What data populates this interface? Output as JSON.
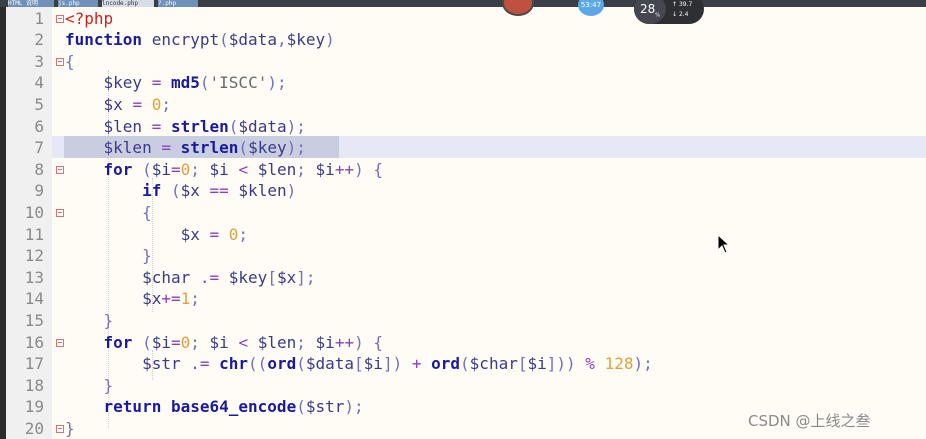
{
  "tabs": [
    "HTML 说明",
    "js.php",
    "lncode.php",
    "?.php"
  ],
  "overlay": {
    "time": "53:47",
    "net_value": "28",
    "net_unit": "%",
    "net_up": "39.7",
    "net_down": "2.4"
  },
  "watermark": "CSDN @上线之叁",
  "lines": [
    {
      "n": "1",
      "fold": true,
      "html": "<span class=\"tag\">&lt;?php</span>"
    },
    {
      "n": "2",
      "fold": false,
      "html": "<span class=\"kw\">function</span> <span class=\"var\">encrypt</span><span class=\"punc\">(</span><span class=\"var\">$data</span><span class=\"punc\">,</span><span class=\"var\">$key</span><span class=\"punc\">)</span>"
    },
    {
      "n": "3",
      "fold": true,
      "html": "<span class=\"punc\">{</span>"
    },
    {
      "n": "4",
      "fold": false,
      "html": "    <span class=\"var\">$key</span> <span class=\"op\">=</span> <span class=\"fn\">md5</span><span class=\"punc\">(</span><span class=\"str\">'ISCC'</span><span class=\"punc\">);</span>"
    },
    {
      "n": "5",
      "fold": false,
      "html": "    <span class=\"var\">$x</span> <span class=\"op\">=</span> <span class=\"num\">0</span><span class=\"punc\">;</span>"
    },
    {
      "n": "6",
      "fold": false,
      "html": "    <span class=\"var\">$len</span> <span class=\"op\">=</span> <span class=\"fn\">strlen</span><span class=\"punc\">(</span><span class=\"var\">$data</span><span class=\"punc\">);</span>"
    },
    {
      "n": "7",
      "fold": false,
      "html": "    <span class=\"var\">$klen</span> <span class=\"op\">=</span> <span class=\"fn\">strlen</span><span class=\"punc\">(</span><span class=\"var\">$key</span><span class=\"punc\">);</span>"
    },
    {
      "n": "8",
      "fold": true,
      "html": "    <span class=\"kw\">for</span> <span class=\"punc\">(</span><span class=\"var\">$i</span><span class=\"op\">=</span><span class=\"num\">0</span><span class=\"punc\">;</span> <span class=\"var\">$i</span> <span class=\"op\">&lt;</span> <span class=\"var\">$len</span><span class=\"punc\">;</span> <span class=\"var\">$i</span><span class=\"op\">++</span><span class=\"punc\">)</span> <span class=\"punc\">{</span>"
    },
    {
      "n": "9",
      "fold": false,
      "html": "        <span class=\"kw\">if</span> <span class=\"punc\">(</span><span class=\"var\">$x</span> <span class=\"op\">==</span> <span class=\"var\">$klen</span><span class=\"punc\">)</span>"
    },
    {
      "n": "10",
      "fold": true,
      "html": "        <span class=\"punc\">{</span>"
    },
    {
      "n": "11",
      "fold": false,
      "html": "            <span class=\"var\">$x</span> <span class=\"op\">=</span> <span class=\"num\">0</span><span class=\"punc\">;</span>"
    },
    {
      "n": "12",
      "fold": false,
      "html": "        <span class=\"punc\">}</span>"
    },
    {
      "n": "13",
      "fold": false,
      "html": "        <span class=\"var\">$char</span> <span class=\"op\">.=</span> <span class=\"var\">$key</span><span class=\"punc\">[</span><span class=\"var\">$x</span><span class=\"punc\">];</span>"
    },
    {
      "n": "14",
      "fold": false,
      "html": "        <span class=\"var\">$x</span><span class=\"op\">+=</span><span class=\"num\">1</span><span class=\"punc\">;</span>"
    },
    {
      "n": "15",
      "fold": false,
      "html": "    <span class=\"punc\">}</span>"
    },
    {
      "n": "16",
      "fold": true,
      "html": "    <span class=\"kw\">for</span> <span class=\"punc\">(</span><span class=\"var\">$i</span><span class=\"op\">=</span><span class=\"num\">0</span><span class=\"punc\">;</span> <span class=\"var\">$i</span> <span class=\"op\">&lt;</span> <span class=\"var\">$len</span><span class=\"punc\">;</span> <span class=\"var\">$i</span><span class=\"op\">++</span><span class=\"punc\">)</span> <span class=\"punc\">{</span>"
    },
    {
      "n": "17",
      "fold": false,
      "html": "        <span class=\"var\">$str</span> <span class=\"op\">.=</span> <span class=\"fn\">chr</span><span class=\"punc\">((</span><span class=\"fn\">ord</span><span class=\"punc\">(</span><span class=\"var\">$data</span><span class=\"punc\">[</span><span class=\"var\">$i</span><span class=\"punc\">])</span> <span class=\"op\">+</span> <span class=\"fn\">ord</span><span class=\"punc\">(</span><span class=\"var\">$char</span><span class=\"punc\">[</span><span class=\"var\">$i</span><span class=\"punc\">]))</span> <span class=\"op\">%</span> <span class=\"num\">128</span><span class=\"punc\">);</span>"
    },
    {
      "n": "18",
      "fold": false,
      "html": "    <span class=\"punc\">}</span>"
    },
    {
      "n": "19",
      "fold": false,
      "html": "    <span class=\"kw\">return</span> <span class=\"fn\">base64_encode</span><span class=\"punc\">(</span><span class=\"var\">$str</span><span class=\"punc\">);</span>"
    },
    {
      "n": "20",
      "fold": true,
      "html": "<span class=\"punc\">}</span>"
    }
  ]
}
